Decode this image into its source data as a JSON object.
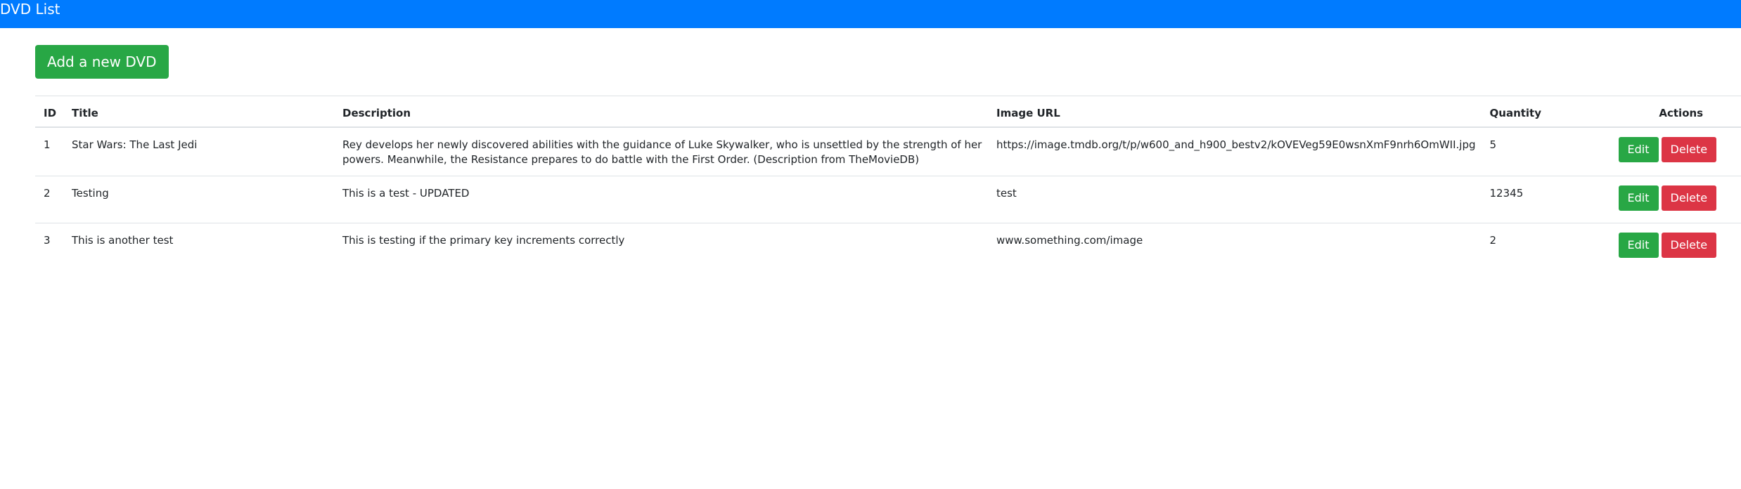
{
  "navbar": {
    "title": "DVD List",
    "color": "#007bff"
  },
  "add_button": {
    "label": "Add a new DVD",
    "color": "#28a745"
  },
  "table": {
    "headers": {
      "id": "ID",
      "title": "Title",
      "description": "Description",
      "image_url": "Image URL",
      "quantity": "Quantity",
      "actions": "Actions"
    },
    "rows": [
      {
        "id": "1",
        "title": "Star Wars: The Last Jedi",
        "description": "Rey develops her newly discovered abilities with the guidance of Luke Skywalker, who is unsettled by the strength of her powers. Meanwhile, the Resistance prepares to do battle with the First Order. (Description from TheMovieDB)",
        "image_url": "https://image.tmdb.org/t/p/w600_and_h900_bestv2/kOVEVeg59E0wsnXmF9nrh6OmWII.jpg",
        "quantity": "5",
        "edit_label": "Edit",
        "delete_label": "Delete"
      },
      {
        "id": "2",
        "title": "Testing",
        "description": "This is a test - UPDATED",
        "image_url": "test",
        "quantity": "12345",
        "edit_label": "Edit",
        "delete_label": "Delete"
      },
      {
        "id": "3",
        "title": "This is another test",
        "description": "This is testing if the primary key increments correctly",
        "image_url": "www.something.com/image",
        "quantity": "2",
        "edit_label": "Edit",
        "delete_label": "Delete"
      }
    ]
  },
  "colors": {
    "success": "#28a745",
    "danger": "#dc3545",
    "border": "#dee2e6"
  }
}
